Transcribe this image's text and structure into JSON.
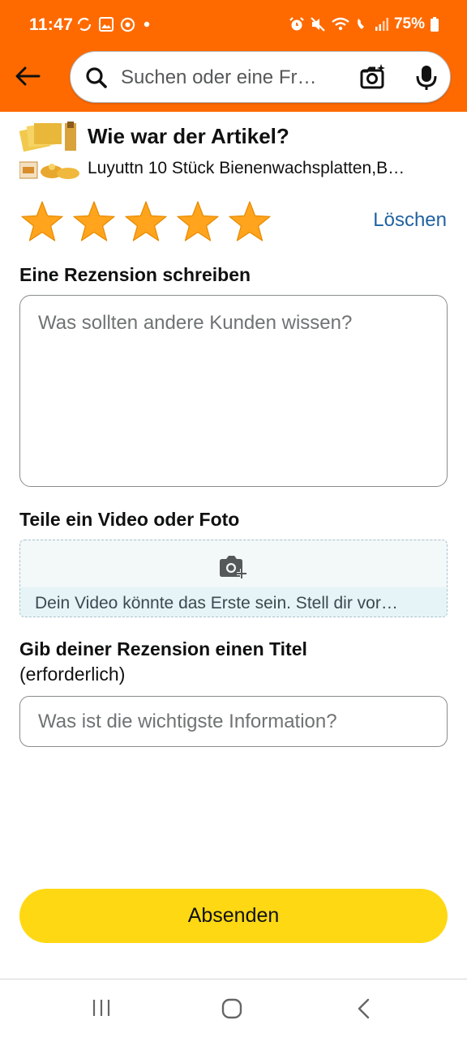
{
  "status_bar": {
    "time": "11:47",
    "battery": "75%",
    "left_icons": [
      "sync-icon",
      "gallery-icon",
      "chrome-icon",
      "dot-icon"
    ],
    "right_icons": [
      "alarm-icon",
      "mute-icon",
      "wifi-icon",
      "wifi-call-icon",
      "signal-icon",
      "battery-icon"
    ]
  },
  "search": {
    "placeholder": "Suchen oder eine Fr…"
  },
  "product": {
    "question": "Wie war der Artikel?",
    "name": "Luyuttn 10 Stück Bienenwachsplatten,B…"
  },
  "rating": {
    "value": 5,
    "max": 5,
    "star_color": "#ffa41c",
    "clear_label": "Löschen"
  },
  "review": {
    "label": "Eine Rezension schreiben",
    "placeholder": "Was sollten andere Kunden wissen?"
  },
  "media": {
    "label": "Teile ein Video oder Foto",
    "prompt": "Dein Video könnte das Erste sein. Stell dir vor…"
  },
  "title_field": {
    "label": "Gib deiner Rezension einen Titel",
    "required_note": "(erforderlich)",
    "placeholder": "Was ist die wichtigste Information?"
  },
  "submit": {
    "label": "Absenden",
    "color": "#ffd814"
  },
  "colors": {
    "header": "#ff6a00",
    "link": "#2162a1"
  }
}
